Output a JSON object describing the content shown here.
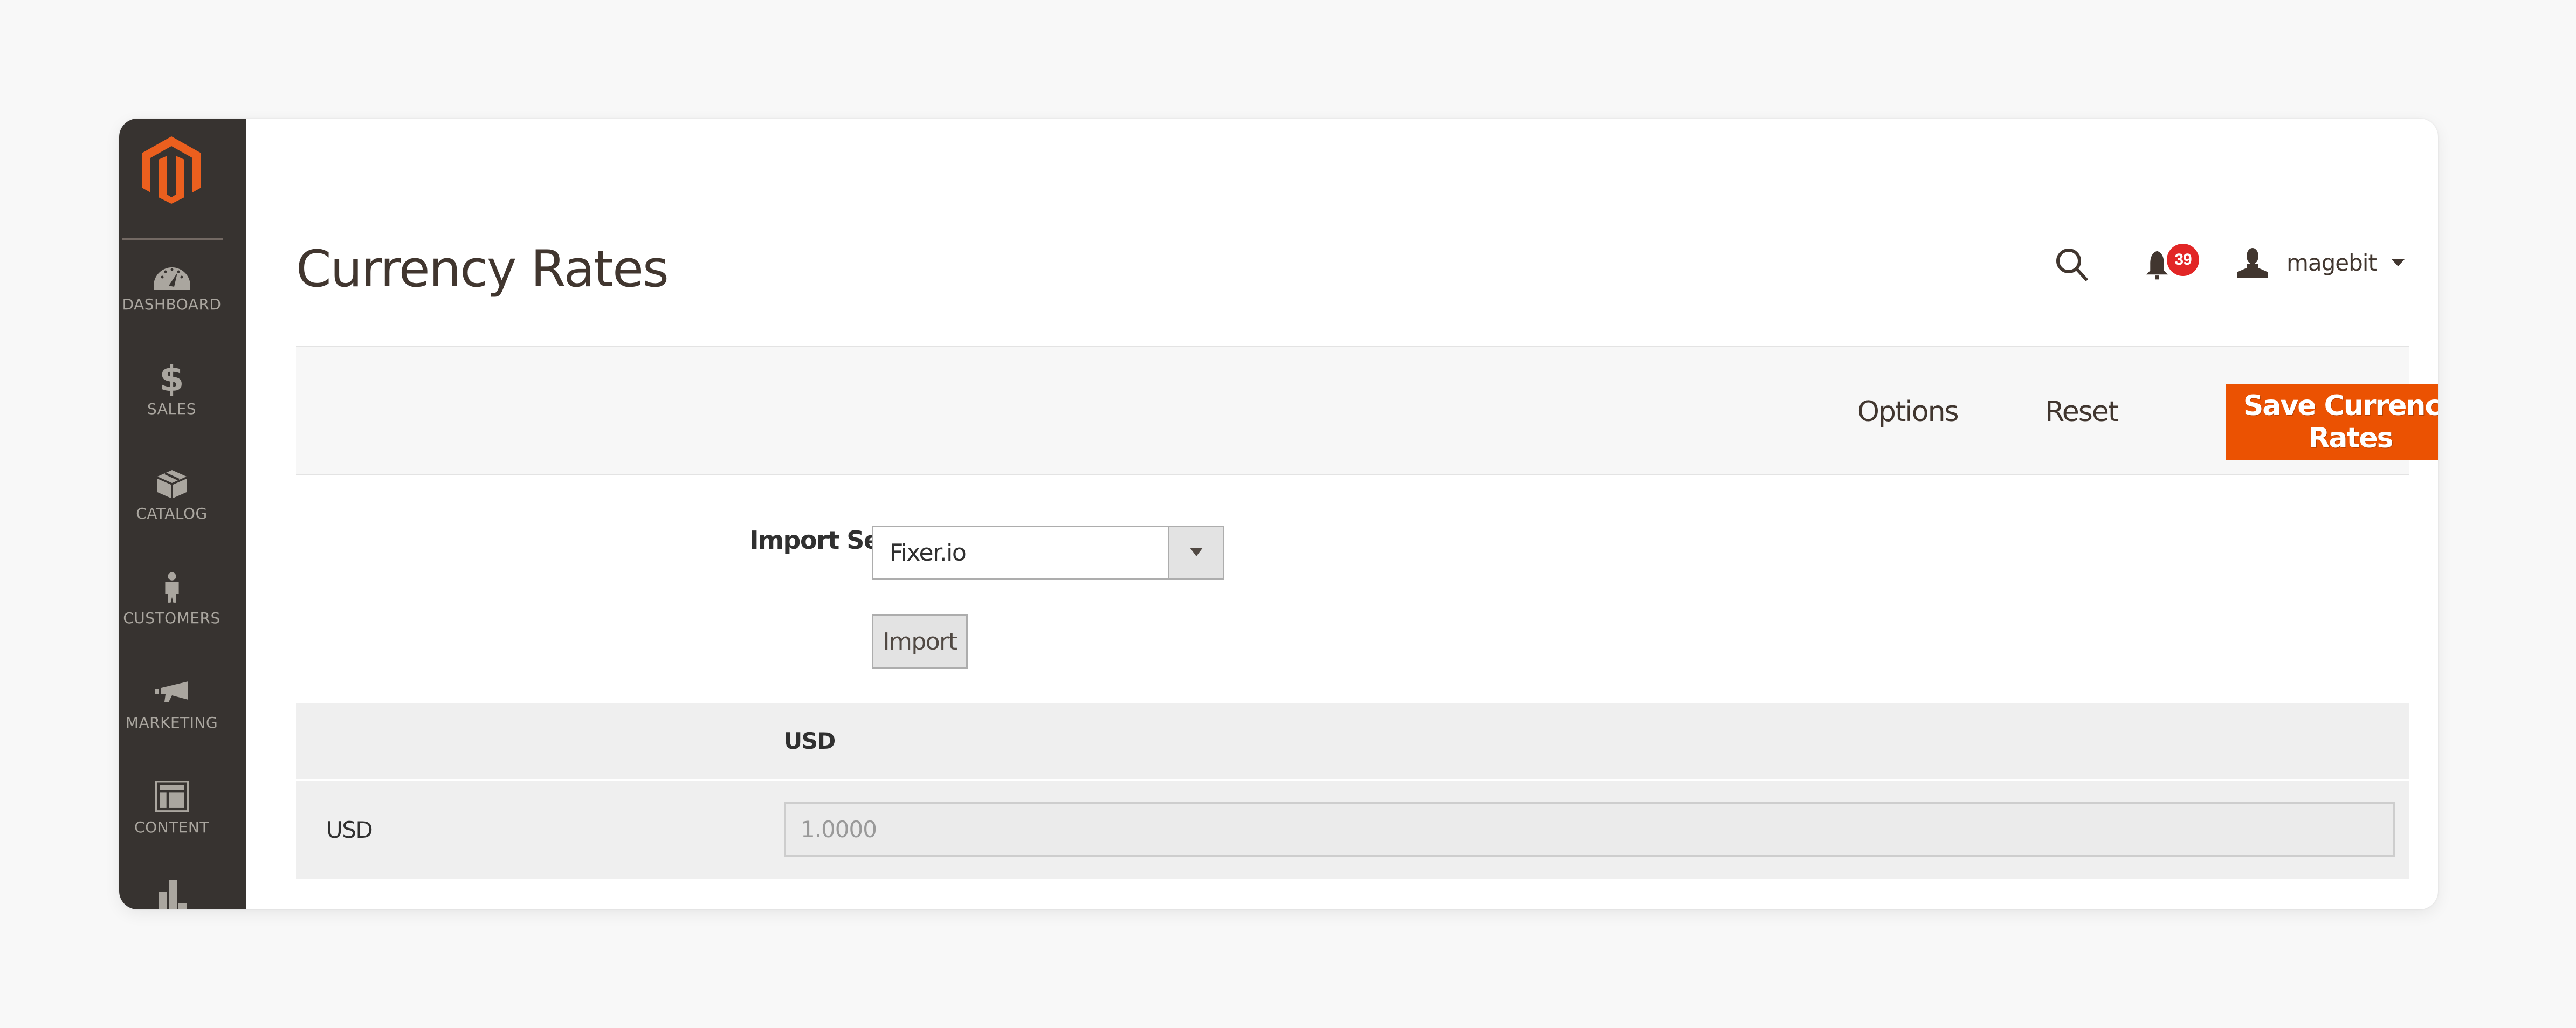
{
  "brand": {
    "logo": "magento-logo-icon",
    "accent_color": "#eb5202",
    "sidebar_color": "#373330"
  },
  "sidebar": {
    "items": [
      {
        "label": "DASHBOARD",
        "icon": "dashboard-gauge-icon"
      },
      {
        "label": "SALES",
        "icon": "dollar-icon"
      },
      {
        "label": "CATALOG",
        "icon": "box-icon"
      },
      {
        "label": "CUSTOMERS",
        "icon": "person-icon"
      },
      {
        "label": "MARKETING",
        "icon": "megaphone-icon"
      },
      {
        "label": "CONTENT",
        "icon": "layout-icon"
      },
      {
        "label": "",
        "icon": "bar-chart-icon"
      }
    ]
  },
  "header": {
    "title": "Currency Rates",
    "search_icon": "search-icon",
    "notifications": {
      "icon": "bell-icon",
      "count": "39",
      "badge_color": "#e22626"
    },
    "user": {
      "icon": "user-icon",
      "name": "magebit"
    }
  },
  "toolbar": {
    "options_label": "Options",
    "reset_label": "Reset",
    "save_label": "Save Currency Rates"
  },
  "form": {
    "import_service_label": "Import Service",
    "import_service_value": "Fixer.io",
    "import_button_label": "Import"
  },
  "rates_table": {
    "columns": [
      "USD"
    ],
    "rows": [
      {
        "currency": "USD",
        "values": [
          "1.0000"
        ]
      }
    ]
  }
}
